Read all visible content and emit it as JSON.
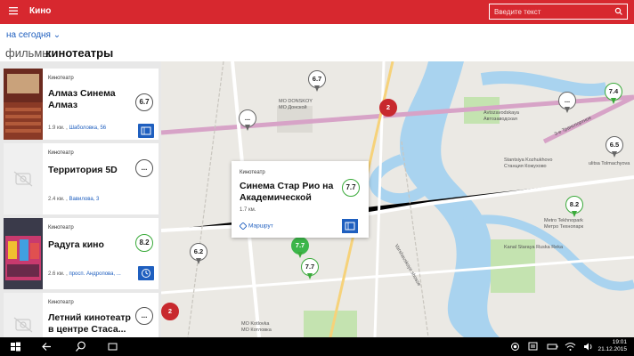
{
  "app": {
    "title": "Кино"
  },
  "search": {
    "placeholder": "Введите текст"
  },
  "filter": {
    "date": "на сегодня"
  },
  "tabs": [
    {
      "label": "фильмы",
      "active": false
    },
    {
      "label": "кинотеатры",
      "active": true
    }
  ],
  "cinemas": [
    {
      "kind": "Кинотеатр",
      "name": "Алмаз Синема Алмаз",
      "rating": "6.7",
      "distance": "1.9 км.",
      "address": "Шаболовка, 56",
      "action_icon": "ticket-icon",
      "has_photo": true
    },
    {
      "kind": "Кинотеатр",
      "name": "Территория 5D",
      "rating": "...",
      "distance": "2.4 км.",
      "address": "Вавилова, 3",
      "action_icon": "",
      "has_photo": false
    },
    {
      "kind": "Кинотеатр",
      "name": "Радуга кино",
      "rating": "8.2",
      "distance": "2.6 км.",
      "address": "просп. Андропова, ...",
      "action_icon": "clock-icon",
      "has_photo": true
    },
    {
      "kind": "Кинотеатр",
      "name": "Летний кинотеатр в центре Стаса...",
      "rating": "...",
      "distance": "",
      "address": "",
      "action_icon": "",
      "has_photo": false
    }
  ],
  "popup": {
    "kind": "Кинотеатр",
    "name": "Синема Стар Рио на Академической",
    "distance": "1.7 км.",
    "rating": "7.7",
    "route_label": "Маршрут"
  },
  "map": {
    "pins": [
      {
        "label": "6.7",
        "style": "grey"
      },
      {
        "label": "2",
        "style": "red"
      },
      {
        "label": "...",
        "style": "grey"
      },
      {
        "label": "7.4",
        "style": "green"
      },
      {
        "label": "...",
        "style": "grey"
      },
      {
        "label": "6.5",
        "style": "grey"
      },
      {
        "label": "8.2",
        "style": "green"
      },
      {
        "label": "7.7",
        "style": "green-fill"
      },
      {
        "label": "7.7",
        "style": "green"
      },
      {
        "label": "6.2",
        "style": "grey"
      },
      {
        "label": "2",
        "style": "red"
      }
    ],
    "labels": [
      "MO DONSKOY",
      "МО Донской",
      "Avtozavodskaya",
      "Автозаводская",
      "3-е Транспортное",
      "Stantsiya Kozhukhovo",
      "Станция Кожухово",
      "Metro Tekhnopark",
      "Метро Технопарк",
      "ulitsa Tolmachyova",
      "MO Kotlovka",
      "МО Котловка",
      "Kanal Staraya Ruska Reka",
      "Varshavskoye shosse"
    ]
  },
  "taskbar": {
    "time": "19:01",
    "date": "21.12.2015"
  },
  "colors": {
    "brand": "#d7282f",
    "accent": "#1f5fbf",
    "rating_green": "#3aaa3a"
  }
}
